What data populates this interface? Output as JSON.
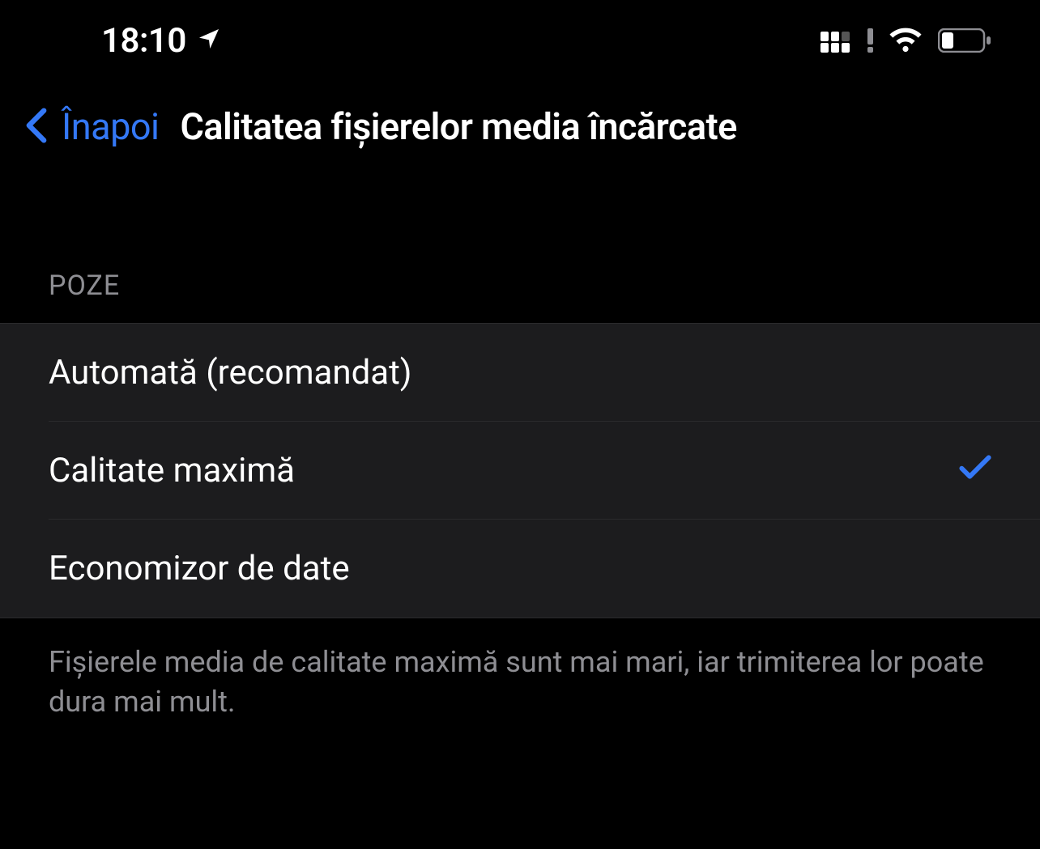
{
  "statusBar": {
    "time": "18:10"
  },
  "navigation": {
    "backLabel": "Înapoi",
    "title": "Calitatea fișierelor media încărcate"
  },
  "section": {
    "header": "POZE",
    "options": [
      {
        "label": "Automată (recomandat)",
        "selected": false
      },
      {
        "label": "Calitate maximă",
        "selected": true
      },
      {
        "label": "Economizor de date",
        "selected": false
      }
    ],
    "footer": "Fișierele media de calitate maximă sunt mai mari, iar trimiterea lor poate dura mai mult."
  }
}
